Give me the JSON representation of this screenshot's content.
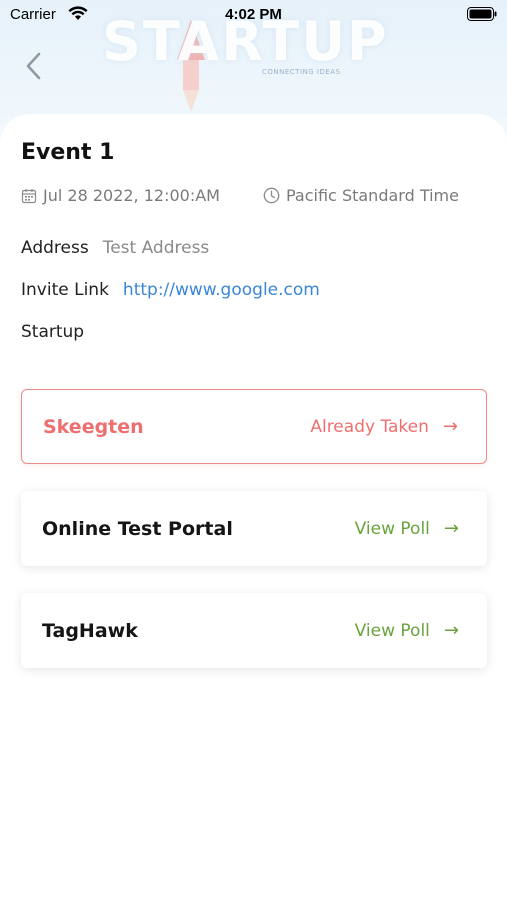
{
  "status_bar": {
    "carrier": "Carrier",
    "time": "4:02 PM"
  },
  "banner": {
    "word": "STARTUP",
    "tagline": "CONNECTING IDEAS"
  },
  "event": {
    "title": "Event 1",
    "date": "Jul 28 2022, 12:00:AM",
    "timezone": "Pacific Standard Time",
    "address_label": "Address",
    "address_value": "Test Address",
    "invite_label": "Invite Link",
    "invite_value": "http://www.google.com",
    "category": "Startup"
  },
  "polls": [
    {
      "title": "Skeegten",
      "action": "Already Taken",
      "arrow": "→",
      "status": "taken"
    },
    {
      "title": "Online Test Portal",
      "action": "View Poll",
      "arrow": "→",
      "status": "open"
    },
    {
      "title": "TagHawk",
      "action": "View Poll",
      "arrow": "→",
      "status": "open"
    }
  ],
  "colors": {
    "taken": "#ee6f6f",
    "view": "#6aa33e",
    "link": "#3a86d8"
  },
  "icons": {
    "back": "chevron-left-icon",
    "date": "calendar-icon",
    "timezone": "clock-icon",
    "arrow": "arrow-right-icon"
  }
}
